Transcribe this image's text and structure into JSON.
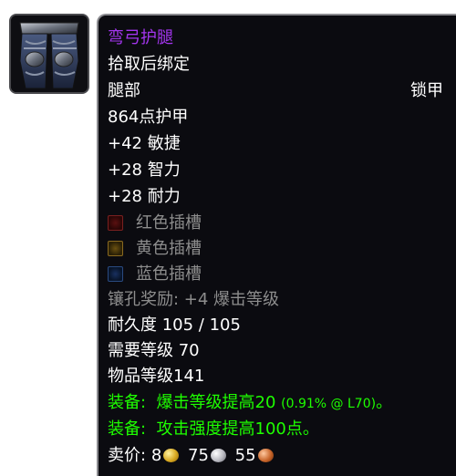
{
  "item": {
    "name": "弯弓护腿",
    "bind": "拾取后绑定",
    "slot": "腿部",
    "armor_type": "锁甲",
    "armor": "864点护甲",
    "stats": [
      "+42 敏捷",
      "+28 智力",
      "+28 耐力"
    ],
    "sockets": [
      {
        "color": "red",
        "label": "红色插槽"
      },
      {
        "color": "yellow",
        "label": "黄色插槽"
      },
      {
        "color": "blue",
        "label": "蓝色插槽"
      }
    ],
    "socket_bonus": "镶孔奖励: +4 爆击等级",
    "durability": "耐久度 105 / 105",
    "required_level": "需要等级 70",
    "item_level": "物品等级141",
    "equip_effects": [
      {
        "prefix": "装备:",
        "text": "爆击等级提高20",
        "detail": "(0.91% @ L70)",
        "suffix": "。"
      },
      {
        "prefix": "装备:",
        "text": "攻击强度提高100点。",
        "detail": "",
        "suffix": ""
      }
    ],
    "sell_price": {
      "label": "卖价:",
      "gold": "8",
      "silver": "75",
      "copper": "55"
    }
  },
  "colors": {
    "epic": "#a335ee",
    "equip_green": "#1eff00",
    "gray": "#8d8d8d",
    "background": "#0b0b10"
  },
  "icon": "leg-armor-icon"
}
